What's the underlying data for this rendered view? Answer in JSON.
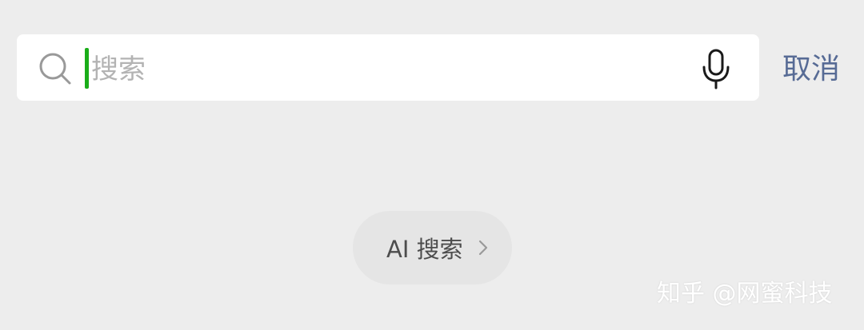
{
  "search": {
    "placeholder": "搜索",
    "value": ""
  },
  "header": {
    "cancel_label": "取消"
  },
  "ai_search": {
    "label": "AI 搜索"
  },
  "watermark": {
    "text": "知乎 @网蜜科技"
  },
  "icons": {
    "search": "search-icon",
    "mic": "mic-icon",
    "chevron": "chevron-right-icon"
  },
  "colors": {
    "background": "#ededed",
    "search_bar": "#ffffff",
    "cursor": "#1aad19",
    "cancel_link": "#576b95",
    "chip_background": "#e5e5e5",
    "placeholder": "#b3b3b3"
  }
}
